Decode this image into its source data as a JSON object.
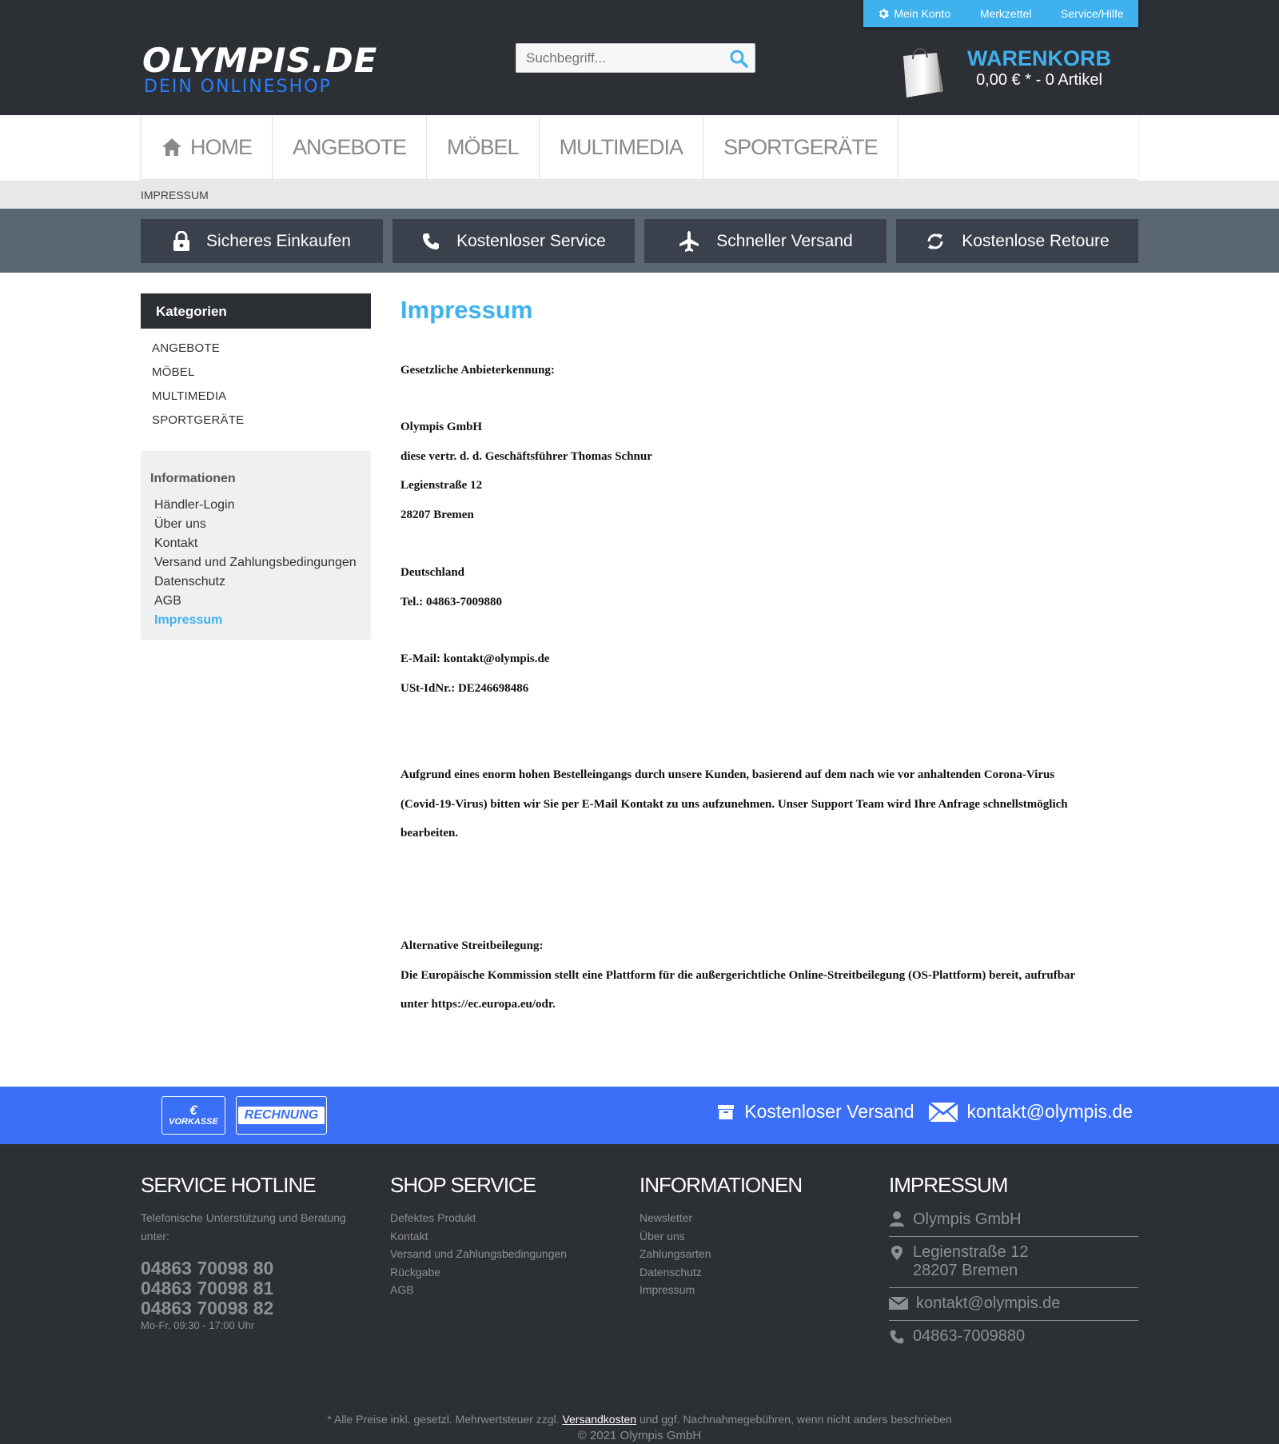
{
  "topbar": {
    "account": "Mein Konto",
    "wishlist": "Merkzettel",
    "service": "Service/Hilfe"
  },
  "logo": {
    "main": "OLYMPIS.DE",
    "sub": "DEIN ONLINESHOP"
  },
  "search": {
    "placeholder": "Suchbegriff..."
  },
  "cart": {
    "title": "WARENKORB",
    "summary": "0,00 € * - 0 Artikel"
  },
  "nav": {
    "home": "HOME",
    "items": [
      "ANGEBOTE",
      "MÖBEL",
      "MULTIMEDIA",
      "SPORTGERÄTE"
    ]
  },
  "breadcrumb": "IMPRESSUM",
  "usp": [
    "Sicheres Einkaufen",
    "Kostenloser Service",
    "Schneller Versand",
    "Kostenlose Retoure"
  ],
  "sidebar": {
    "categories_title": "Kategorien",
    "categories": [
      "ANGEBOTE",
      "MÖBEL",
      "MULTIMEDIA",
      "SPORTGERÄTE"
    ],
    "info_title": "Informationen",
    "info": [
      "Händler-Login",
      "Über uns",
      "Kontakt",
      "Versand und Zahlungsbedingungen",
      "Datenschutz",
      "AGB",
      "Impressum"
    ]
  },
  "content": {
    "title": "Impressum",
    "provider_label": "Gesetzliche Anbieterkennung:",
    "company": "Olympis GmbH",
    "representative": "diese vertr. d. d. Geschäftsführer Thomas Schnur",
    "street": "Legienstraße 12",
    "city": "28207 Bremen",
    "country": "Deutschland",
    "phone": "Tel.: 04863-7009880",
    "email": "E-Mail: kontakt@olympis.de",
    "vat": "USt-IdNr.: DE246698486",
    "notice_1": "Aufgrund eines enorm hohen Bestelleingangs durch unsere Kunden, basierend auf dem nach wie vor anhaltenden Corona-Virus",
    "notice_2": "(Covid-19-Virus) bitten wir Sie per E-Mail Kontakt zu uns aufzunehmen. Unser Support Team wird Ihre Anfrage schnellstmöglich",
    "notice_3": "bearbeiten.",
    "dispute_label": "Alternative Streitbeilegung:",
    "dispute_1": "Die Europäische Kommission stellt eine Plattform für die außergerichtliche Online-Streitbeilegung (OS-Plattform) bereit, aufrufbar",
    "dispute_2": "unter https://ec.europa.eu/odr."
  },
  "paybar": {
    "vorkasse_symbol": "€",
    "vorkasse": "VORKASSE",
    "rechnung": "RECHNUNG",
    "shipping": "Kostenloser Versand",
    "email": "kontakt@olympis.de"
  },
  "footer": {
    "hotline": {
      "title": "SERVICE HOTLINE",
      "text": "Telefonische Unterstützung und Beratung unter:",
      "phones": [
        "04863 70098 80",
        "04863 70098 81",
        "04863 70098 82"
      ],
      "hours": "Mo-Fr, 09:30 - 17:00 Uhr"
    },
    "shop_service": {
      "title": "SHOP SERVICE",
      "links": [
        "Defektes Produkt",
        "Kontakt",
        "Versand und Zahlungsbedingungen",
        "Rückgabe",
        "AGB"
      ]
    },
    "informationen": {
      "title": "INFORMATIONEN",
      "links": [
        "Newsletter",
        "Über uns",
        "Zahlungsarten",
        "Datenschutz",
        "Impressum"
      ]
    },
    "impressum": {
      "title": "IMPRESSUM",
      "company": "Olympis GmbH",
      "street": "Legienstraße 12",
      "city": "28207 Bremen",
      "email": "kontakt@olympis.de",
      "phone": "04863-7009880"
    },
    "note_before": "* Alle Preise inkl. gesetzl. Mehrwertsteuer zzgl. ",
    "note_link": "Versandkosten",
    "note_after": " und ggf. Nachnahmegebühren, wenn nicht anders beschrieben",
    "copyright": "© 2021 Olympis GmbH"
  },
  "colors": {
    "accent": "#3fb1ee",
    "dark": "#2c2f33",
    "paybar": "#3b6ff8",
    "usp_bar": "#5b6675"
  }
}
